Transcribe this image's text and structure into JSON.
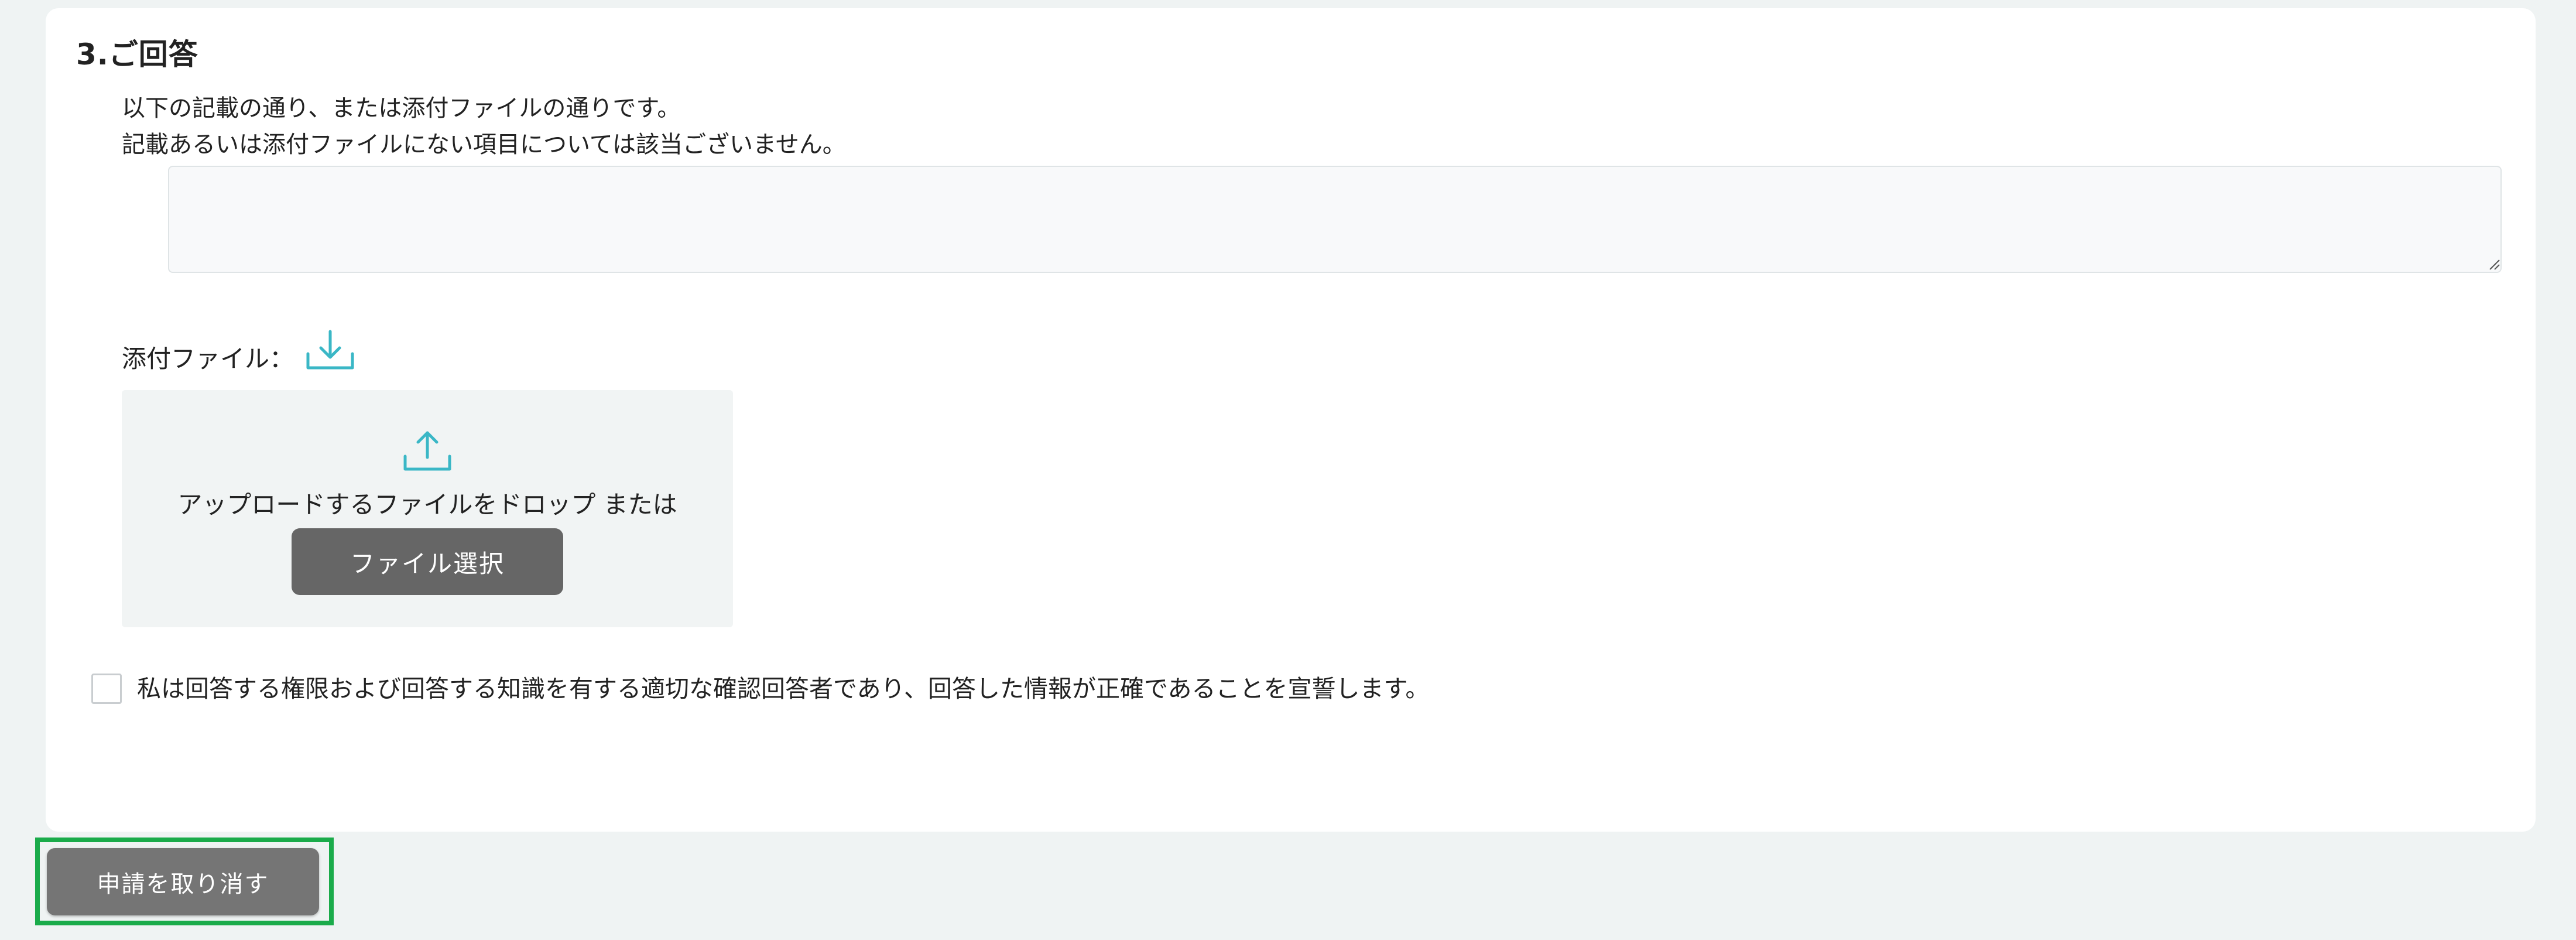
{
  "section": {
    "title": "3.ご回答",
    "description_line1": "以下の記載の通り、または添付ファイルの通りです。",
    "description_line2": "記載あるいは添付ファイルにない項目については該当ございません。",
    "answer_value": ""
  },
  "attachment": {
    "label": "添付ファイル：",
    "download_icon": "download-icon",
    "upload_icon": "upload-icon",
    "drop_text": "アップロードするファイルをドロップ または",
    "file_select_label": "ファイル選択"
  },
  "declaration": {
    "checked": false,
    "text": "私は回答する権限および回答する知識を有する適切な確認回答者であり、回答した情報が正確であることを宣誓します。"
  },
  "footer": {
    "cancel_label": "申請を取り消す"
  },
  "colors": {
    "accent": "#3ab7c6",
    "page_bg": "#eff3f3",
    "button_gray": "#666666",
    "highlight_green": "#1aab4a"
  }
}
